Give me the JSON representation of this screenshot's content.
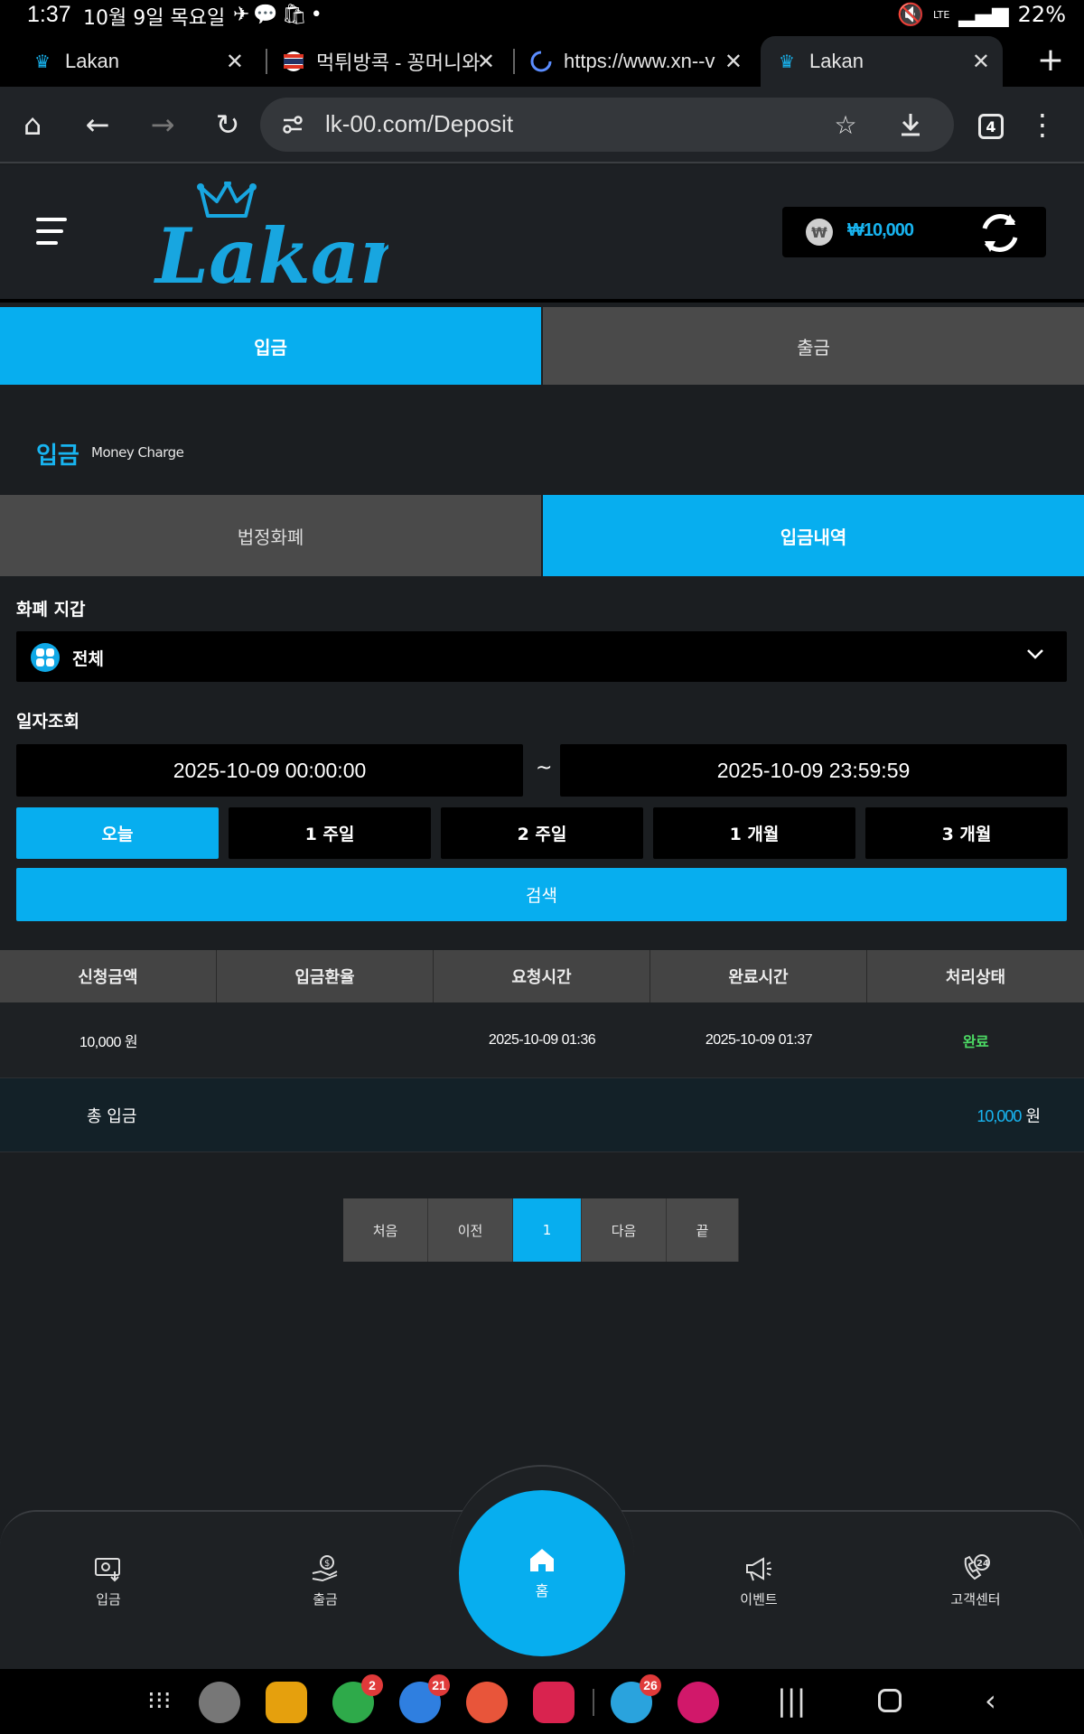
{
  "status_bar": {
    "time": "1:37",
    "date": "10월 9일 목요일",
    "battery": "22%",
    "network": "LTE"
  },
  "browser": {
    "tabs": [
      {
        "title": "Lakan",
        "favicon": "crown-icon"
      },
      {
        "title": "먹튀방콕 - 꽁머니와",
        "favicon": "thailand-flag-icon"
      },
      {
        "title": "https://www.xn--v",
        "favicon": "loading-spinner-icon"
      },
      {
        "title": "Lakan",
        "favicon": "crown-icon",
        "active": true
      }
    ],
    "url": "lk-00.com/Deposit",
    "tab_count": "4"
  },
  "header": {
    "logo_text": "Lakan",
    "balance": "₩10,000",
    "won_symbol": "₩"
  },
  "main_tabs": {
    "deposit": "입금",
    "withdraw": "출금"
  },
  "section": {
    "title": "입금",
    "subtitle": "Money Charge"
  },
  "sub_tabs": {
    "fiat": "법정화폐",
    "history": "입금내역"
  },
  "filters": {
    "wallet_label": "화폐 지갑",
    "wallet_value": "전체",
    "date_label": "일자조회",
    "date_from": "2025-10-09 00:00:00",
    "date_to": "2025-10-09 23:59:59",
    "tilde": "~",
    "ranges": [
      "오늘",
      "1 주일",
      "2 주일",
      "1 개월",
      "3 개월"
    ],
    "search": "검색"
  },
  "table": {
    "headers": [
      "신청금액",
      "입금환율",
      "요청시간",
      "완료시간",
      "처리상태"
    ],
    "rows": [
      {
        "amount": "10,000 원",
        "rate": "",
        "requested": "2025-10-09 01:36",
        "completed": "2025-10-09 01:37",
        "status": "완료"
      }
    ],
    "total_label": "총 입금",
    "total_amount": "10,000",
    "total_unit": "원"
  },
  "pagination": {
    "first": "처음",
    "prev": "이전",
    "current": "1",
    "next": "다음",
    "last": "끝"
  },
  "bottom_nav": {
    "deposit": "입금",
    "withdraw": "출금",
    "home": "홈",
    "event": "이벤트",
    "support": "고객센터"
  },
  "dock": {
    "badges": {
      "phone": "2",
      "messages": "21",
      "telegram": "26"
    }
  },
  "colors": {
    "accent": "#07aeef",
    "success": "#4cd964",
    "background": "#1b1e21"
  }
}
